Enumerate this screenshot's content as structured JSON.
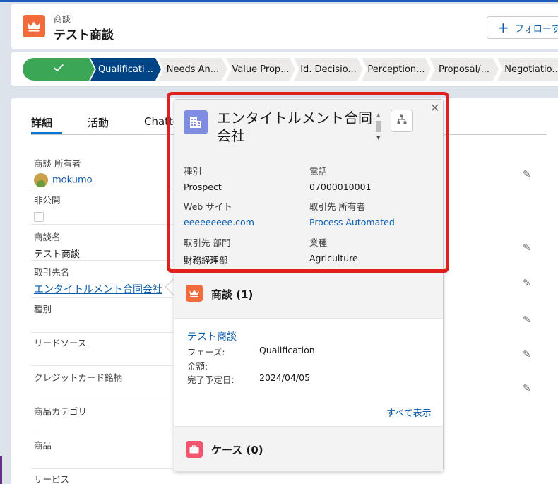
{
  "header": {
    "object_label": "商談",
    "record_title": "テスト商談",
    "follow_label": "フォローす"
  },
  "path": {
    "stages": [
      "",
      "Qualificati...",
      "Needs An...",
      "Value Prop...",
      "Id. Decisio...",
      "Perception...",
      "Proposal/...",
      "Negotiatio..."
    ],
    "completed_index": 0,
    "current_index": 1
  },
  "tabs": [
    "詳細",
    "活動",
    "Chatter"
  ],
  "details": {
    "owner_label": "商談 所有者",
    "owner_value": "mokumo",
    "private_label": "非公開",
    "name_label": "商談名",
    "name_value": "テスト商談",
    "account_label": "取引先名",
    "account_value": "エンタイトルメント合同会社",
    "type_label": "種別",
    "lead_source_label": "リードソース",
    "credit_card_label": "クレジットカード銘柄",
    "product_category_label": "商品カテゴリ",
    "product_label": "商品",
    "service_label": "サービス"
  },
  "popover": {
    "account_name": "エンタイトルメント合同会社",
    "type_label": "種別",
    "type_value": "Prospect",
    "phone_label": "電話",
    "phone_value": "07000010001",
    "website_label": "Web サイト",
    "website_value": "eeeeeeeee.com",
    "owner_label": "取引先 所有者",
    "owner_value": "Process Automated",
    "department_label": "取引先 部門",
    "department_value": "財務経理部",
    "industry_label": "業種",
    "industry_value": "Agriculture",
    "opportunities_title": "商談 (1)",
    "opp_name": "テスト商談",
    "opp_stage_label": "フェーズ:",
    "opp_stage_value": "Qualification",
    "opp_amount_label": "金額:",
    "opp_close_label": "完了予定日:",
    "opp_close_value": "2024/04/05",
    "view_all": "すべて表示",
    "cases_title": "ケース (0)"
  },
  "colors": {
    "opportunity_icon": "#f26b3a",
    "account_icon": "#7f8de1",
    "case_icon": "#f2536d",
    "path_complete": "#3ba755",
    "path_current": "#014486",
    "highlight_border": "#e0201e",
    "link": "#0b5cab"
  },
  "icons": {
    "opportunity": "crown-icon",
    "account": "building-icon",
    "hierarchy": "hierarchy-icon",
    "case": "briefcase-icon",
    "edit": "pencil-icon",
    "check": "check-icon",
    "close": "close-icon"
  }
}
